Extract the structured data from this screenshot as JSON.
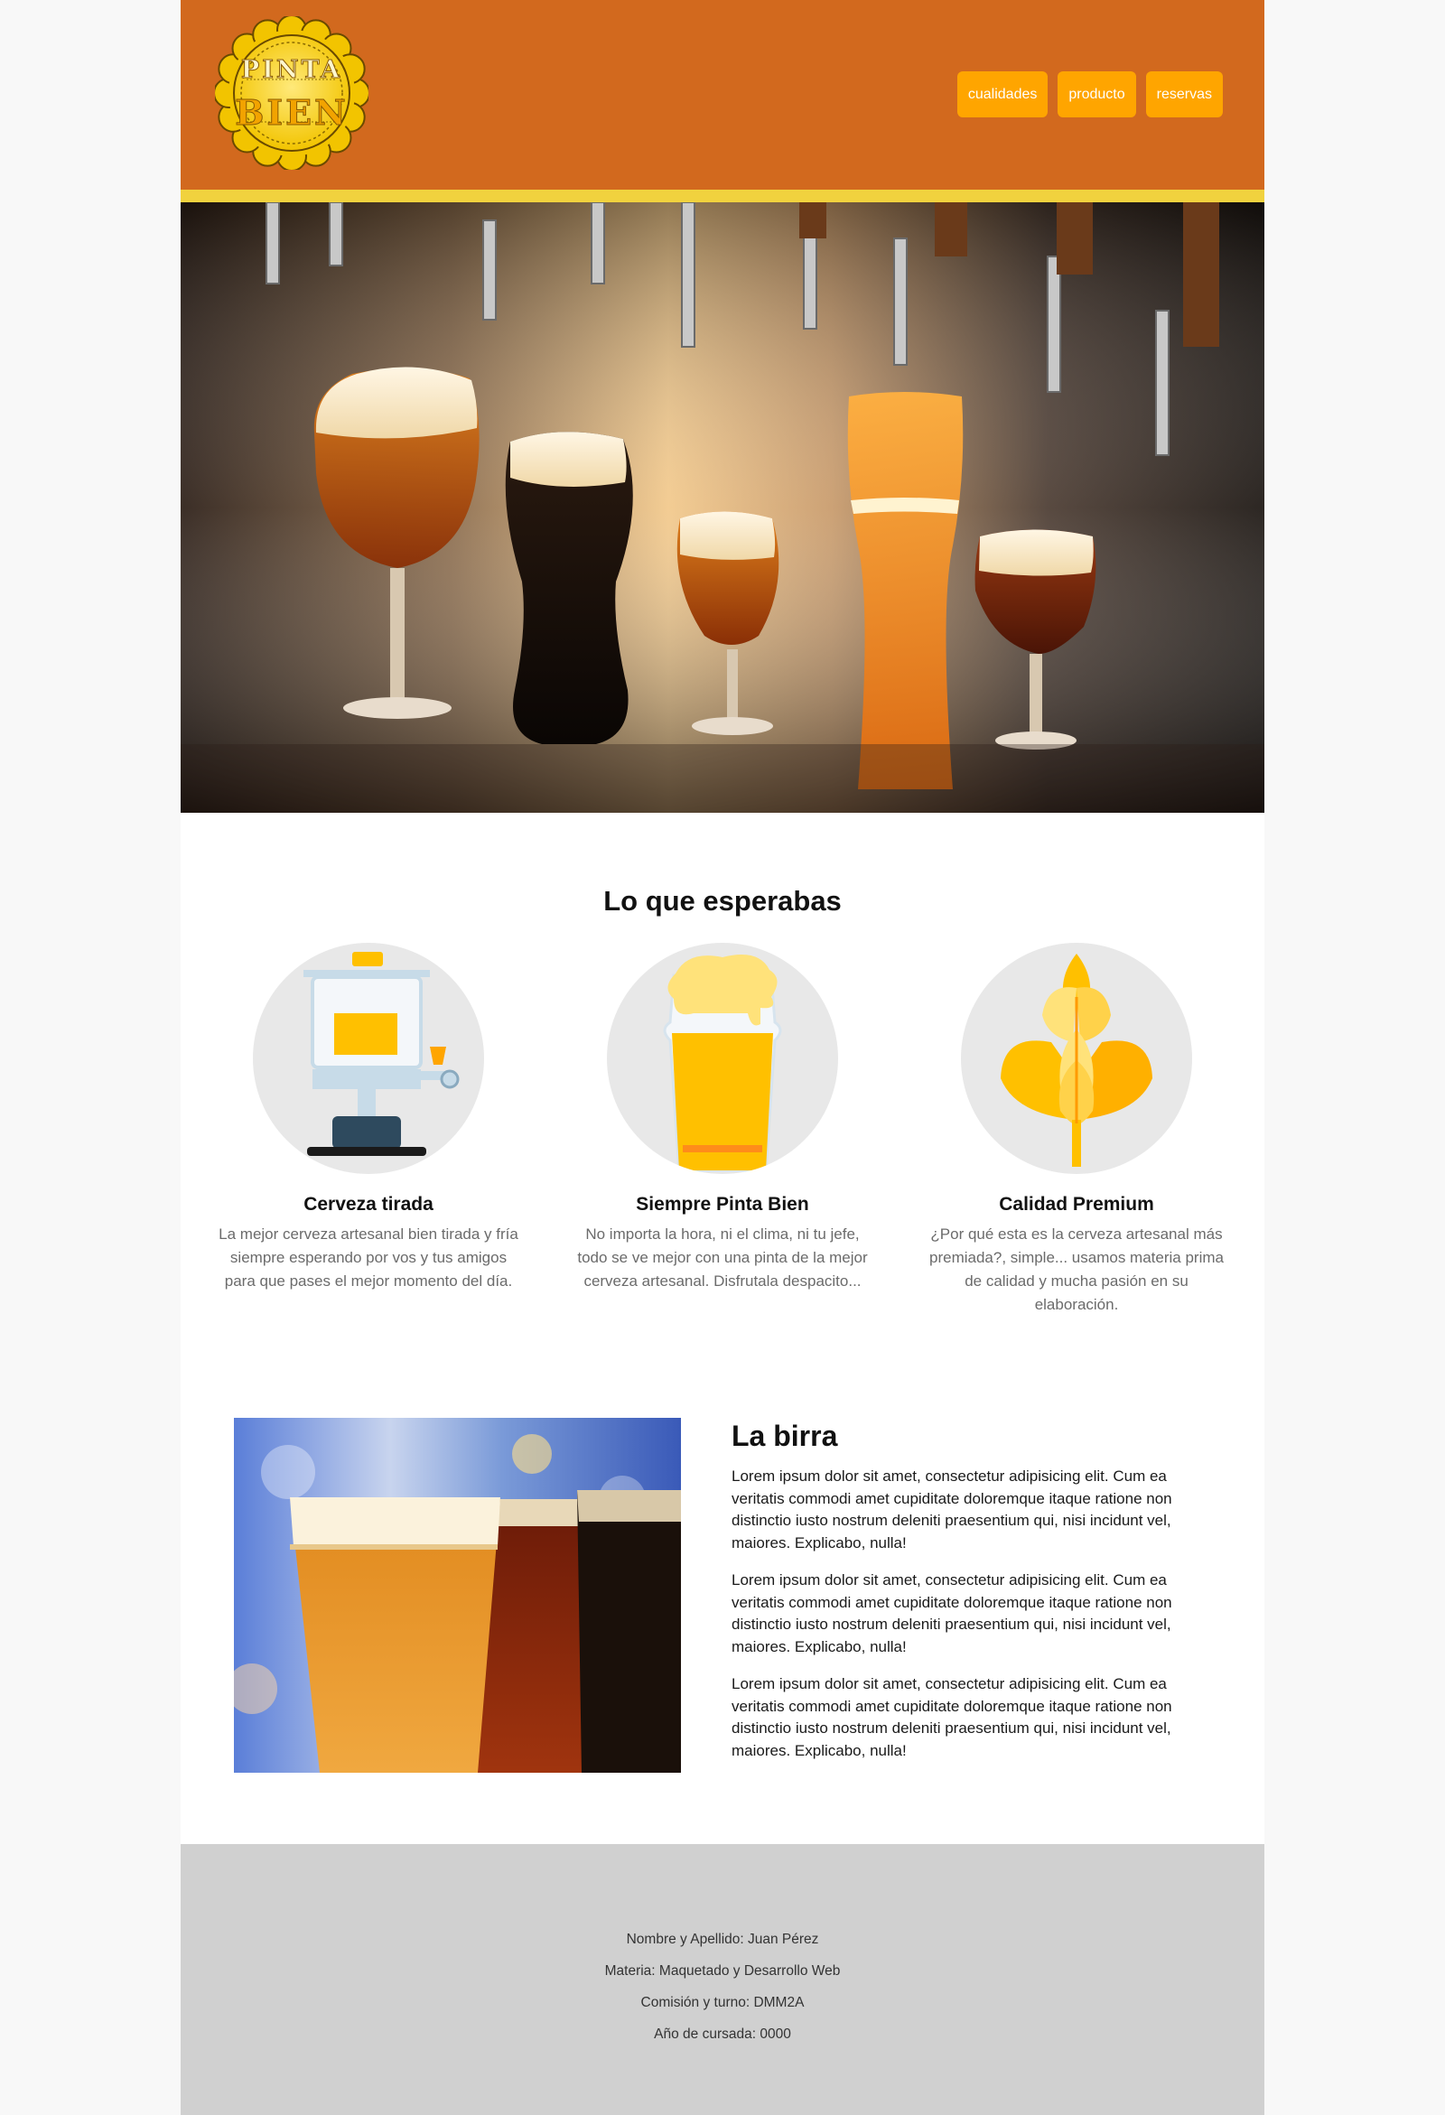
{
  "logo": {
    "line1": "PINTA",
    "line2": "BIEN"
  },
  "nav": {
    "items": [
      "cualidades",
      "producto",
      "reservas"
    ]
  },
  "features": {
    "title": "Lo que esperabas",
    "items": [
      {
        "icon": "beer-keg-icon",
        "title": "Cerveza tirada",
        "text": "La mejor cerveza artesanal bien tirada y fría siempre esperando por vos y tus amigos para que pases el mejor momento del día."
      },
      {
        "icon": "pint-glass-icon",
        "title": "Siempre Pinta Bien",
        "text": "No importa la hora, ni el clima, ni tu jefe, todo se ve mejor con una pinta de la mejor cerveza artesanal. Disfrutala despacito..."
      },
      {
        "icon": "wheat-icon",
        "title": "Calidad Premium",
        "text": "¿Por qué esta es la cerveza artesanal más premiada?, simple... usamos materia prima de calidad y mucha pasión en su elaboración."
      }
    ]
  },
  "birra": {
    "title": "La birra",
    "paragraphs": [
      "Lorem ipsum dolor sit amet, consectetur adipisicing elit. Cum ea veritatis commodi amet cupiditate doloremque itaque ratione non distinctio iusto nostrum deleniti praesentium qui, nisi incidunt vel, maiores. Explicabo, nulla!",
      "Lorem ipsum dolor sit amet, consectetur adipisicing elit. Cum ea veritatis commodi amet cupiditate doloremque itaque ratione non distinctio iusto nostrum deleniti praesentium qui, nisi incidunt vel, maiores. Explicabo, nulla!",
      "Lorem ipsum dolor sit amet, consectetur adipisicing elit. Cum ea veritatis commodi amet cupiditate doloremque itaque ratione non distinctio iusto nostrum deleniti praesentium qui, nisi incidunt vel, maiores. Explicabo, nulla!"
    ]
  },
  "footer": {
    "lines": [
      "Nombre y Apellido: Juan Pérez",
      "Materia: Maquetado y Desarrollo Web",
      "Comisión y turno: DMM2A",
      "Año de cursada: 0000"
    ]
  },
  "colors": {
    "header": "#d2691e",
    "stripe": "#f1d23e",
    "nav_button": "#ffa500",
    "footer": "#d0d0d0",
    "icon_circle": "#e8e8e8",
    "accent_yellow": "#ffc000"
  }
}
